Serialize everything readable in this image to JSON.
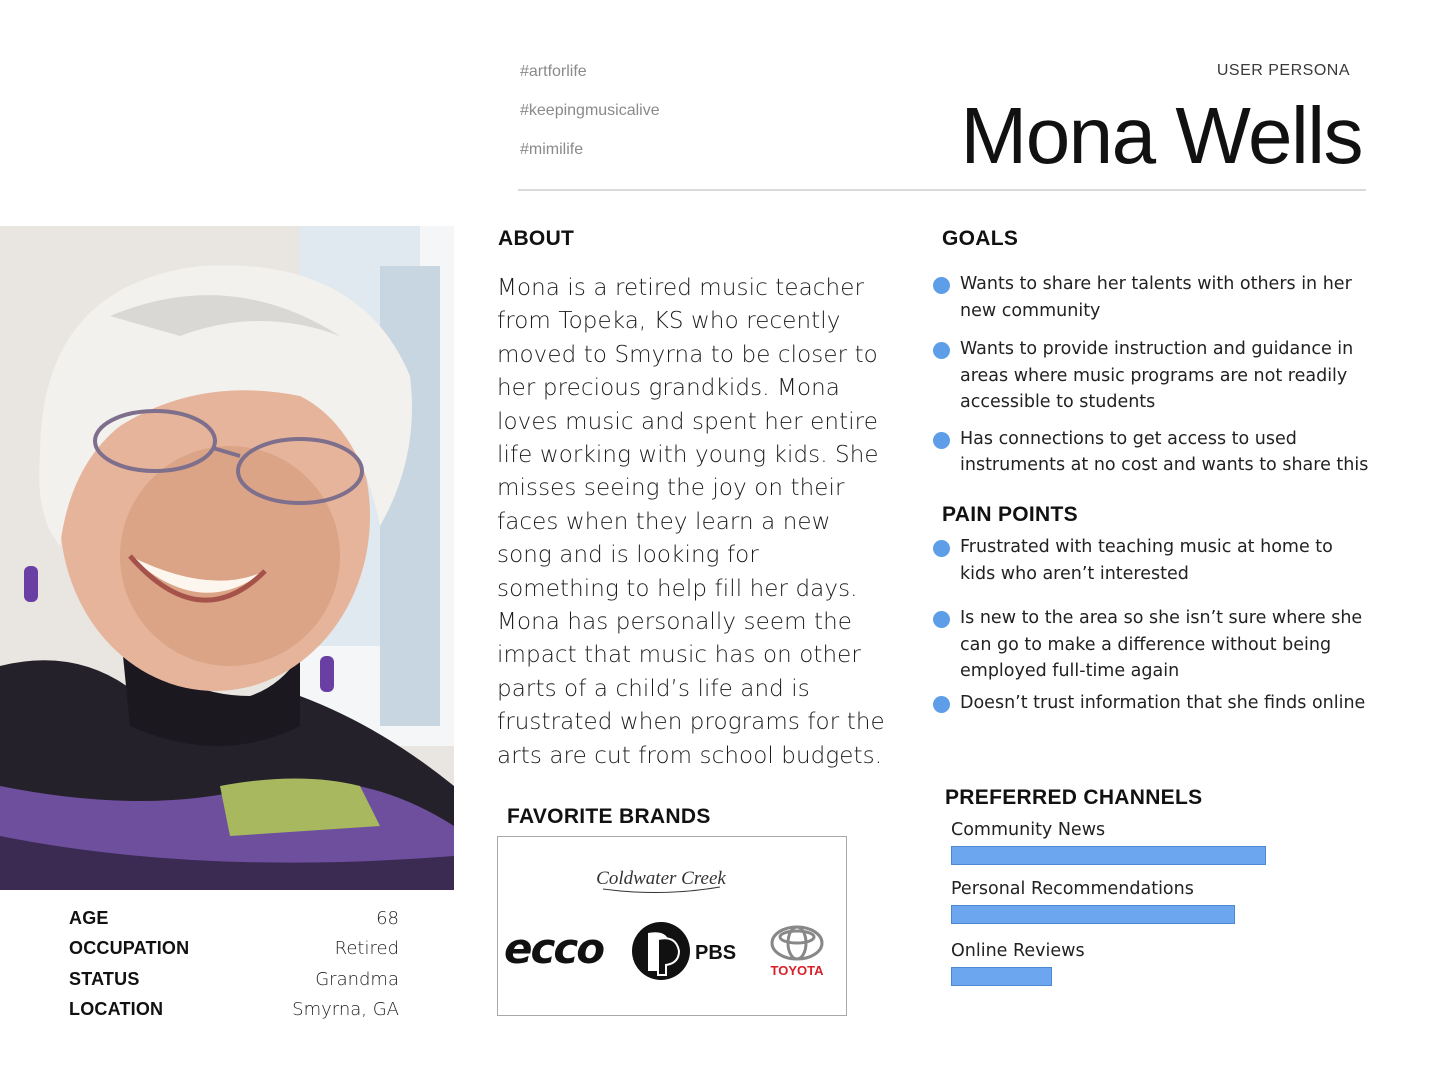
{
  "header": {
    "hashtags": [
      "#artforlife",
      "#keepingmusicalive",
      "#mimilife"
    ],
    "label": "USER PERSONA",
    "name": "Mona Wells"
  },
  "profile": {
    "age_label": "AGE",
    "age": "68",
    "occupation_label": "OCCUPATION",
    "occupation": "Retired",
    "status_label": "STATUS",
    "status": "Grandma",
    "location_label": "LOCATION",
    "location": "Smyrna, GA"
  },
  "about": {
    "heading": "ABOUT",
    "text": "Mona is a retired music teacher from Topeka, KS who recently moved to Smyrna to be closer to her precious grandkids. Mona loves music and spent her entire life working with young kids.  She misses seeing the joy on their faces when they learn a new song and is looking for something to help fill her days. Mona has personally seem the impact that music has on other parts of a child’s life and is frustrated when programs for the arts are cut from school budgets."
  },
  "goals": {
    "heading": "GOALS",
    "items": [
      "Wants to share her talents with others in her new community",
      "Wants to provide instruction and guidance in areas where music programs are not readily accessible to students",
      "Has connections to get access to used instruments at no cost and wants to share this"
    ]
  },
  "pain_points": {
    "heading": "PAIN POINTS",
    "items": [
      "Frustrated with teaching music at home to kids who aren’t interested",
      "Is new to the area so she isn’t sure where she can go to make a difference without being employed full-time again",
      "Doesn’t trust information that she finds online"
    ]
  },
  "brands": {
    "heading": "FAVORITE BRANDS",
    "logos": [
      "Coldwater Creek",
      "ecco",
      "PBS",
      "TOYOTA"
    ]
  },
  "channels": {
    "heading": "PREFERRED CHANNELS",
    "items": [
      {
        "label": "Community News",
        "level": 1.0
      },
      {
        "label": "Personal Recommendations",
        "level": 0.9
      },
      {
        "label": "Online Reviews",
        "level": 0.32
      }
    ]
  },
  "colors": {
    "accent": "#5e9ee8",
    "bar": "#6ba6ee"
  }
}
